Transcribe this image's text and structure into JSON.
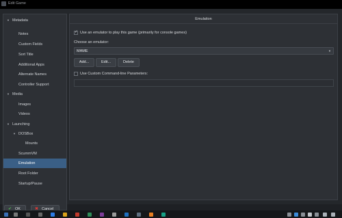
{
  "window": {
    "title": "Edit Game"
  },
  "sidebar": {
    "items": [
      {
        "label": "Metadata",
        "expanded": true
      },
      {
        "label": "Notes"
      },
      {
        "label": "Custom Fields"
      },
      {
        "label": "Sort Title"
      },
      {
        "label": "Additional Apps"
      },
      {
        "label": "Alternate Names"
      },
      {
        "label": "Controller Support"
      },
      {
        "label": "Media",
        "expanded": true
      },
      {
        "label": "Images"
      },
      {
        "label": "Videos"
      },
      {
        "label": "Launching",
        "expanded": true
      },
      {
        "label": "DOSBox",
        "expanded": true
      },
      {
        "label": "Mounts"
      },
      {
        "label": "ScummVM"
      },
      {
        "label": "Emulation",
        "selected": true
      },
      {
        "label": "Root Folder"
      },
      {
        "label": "Startup/Pause"
      }
    ]
  },
  "panel": {
    "title": "Emulation",
    "use_emulator": {
      "label": "Use an emulator to play this game (primarily for console games)",
      "checked": true
    },
    "choose_label": "Choose an emulator:",
    "emulator_select": {
      "value": "MAME"
    },
    "buttons": {
      "add": "Add...",
      "edit": "Edit...",
      "delete": "Delete"
    },
    "custom_params": {
      "label": "Use Custom Command-line Parameters:",
      "checked": false,
      "value": ""
    }
  },
  "footer": {
    "ok_label": "OK",
    "cancel_label": "Cancel"
  },
  "colors": {
    "accent": "#3a5f86",
    "ok": "#4caf50",
    "cancel": "#e53935"
  }
}
